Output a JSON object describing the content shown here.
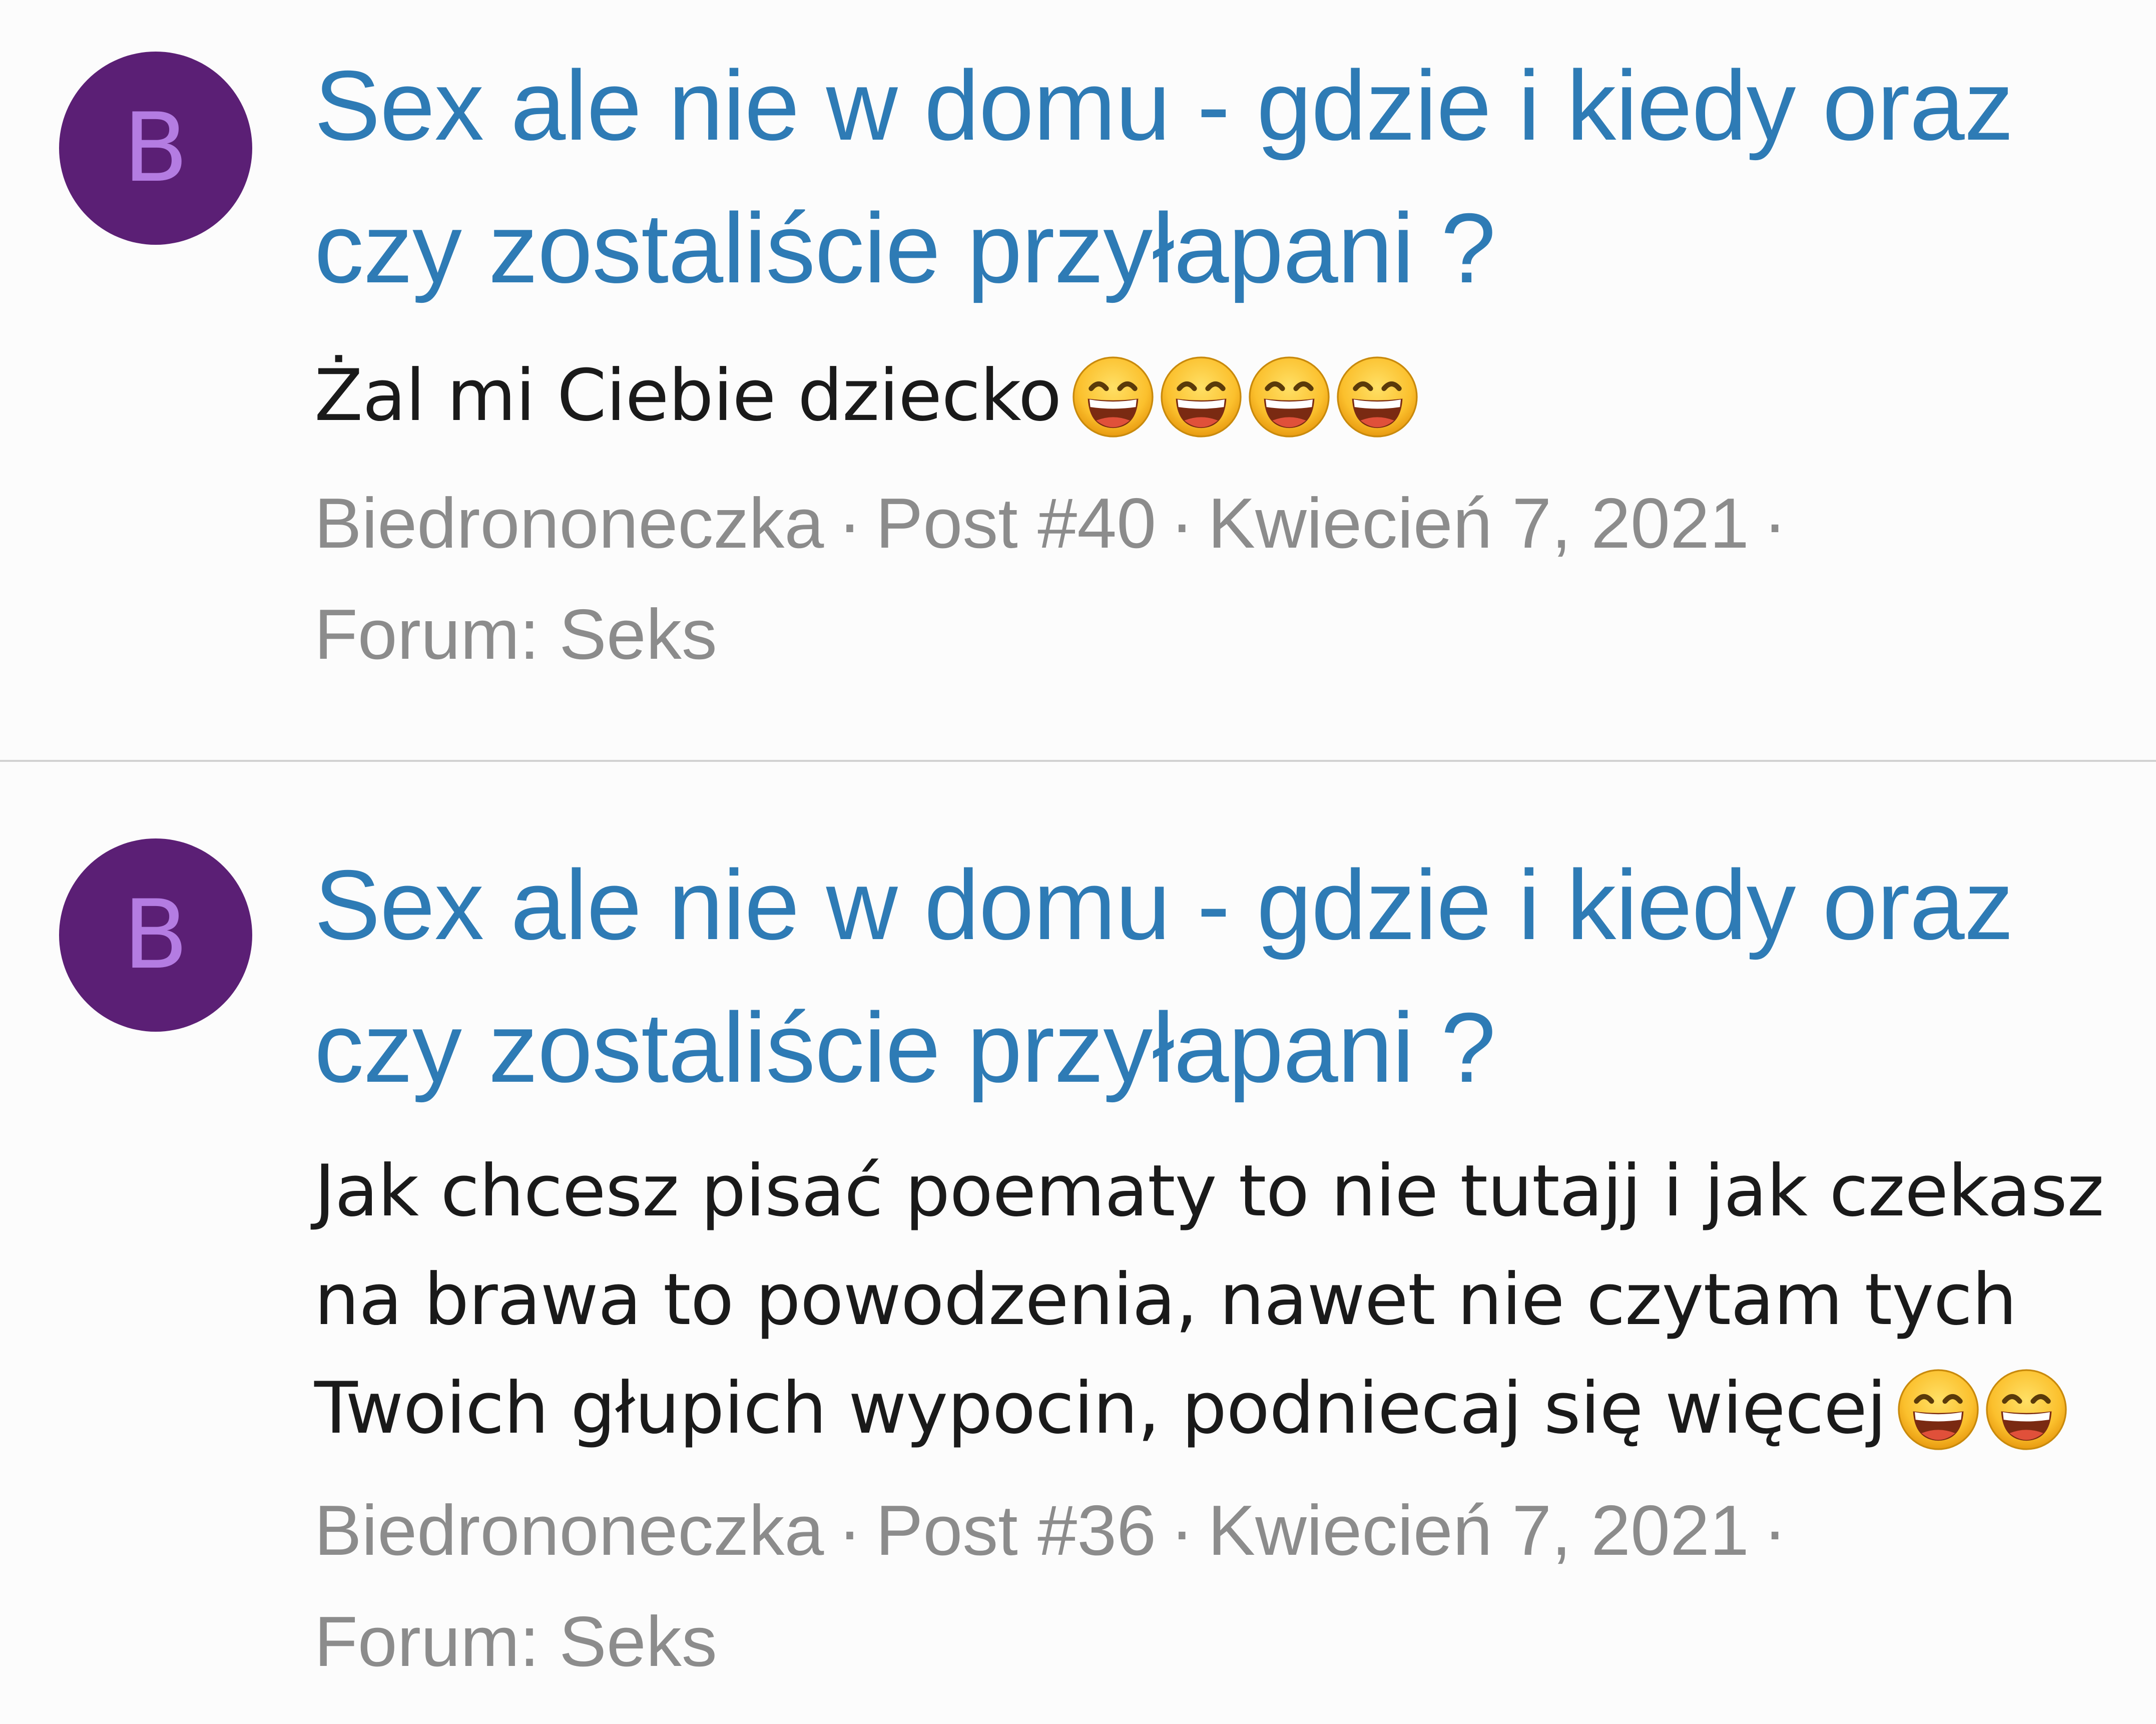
{
  "results": [
    {
      "avatar_letter": "B",
      "title_lines": [
        "Sex ale nie w domu - gdzie i kiedy oraz",
        "czy zostaliście przyłapani ?"
      ],
      "body_lines": [
        "Żal mi Ciebie dziecko"
      ],
      "emoji_count": 4,
      "emoji_icon": "grinning-face-with-smiling-eyes",
      "author": "Biedrononeczka",
      "post": "Post #40",
      "date": "Kwiecień 7, 2021",
      "forum": "Forum: Seks",
      "separator": "·"
    },
    {
      "avatar_letter": "B",
      "title_lines": [
        "Sex ale nie w domu - gdzie i kiedy oraz",
        "czy zostaliście przyłapani ?"
      ],
      "body_lines": [
        "Jak chcesz pisać poematy to nie tutajj i jak czekasz",
        "na brawa to powodzenia, nawet nie czytam tych",
        "Twoich głupich wypocin, podniecaj się więcej"
      ],
      "emoji_count": 2,
      "emoji_icon": "grinning-face-with-smiling-eyes",
      "author": "Biedrononeczka",
      "post": "Post #36",
      "date": "Kwiecień 7, 2021",
      "forum": "Forum: Seks",
      "separator": "·"
    }
  ],
  "colors": {
    "title": "#2e7bb5",
    "avatar_bg": "#5b1f75",
    "avatar_letter": "#b47ce2",
    "meta": "#8c8c8c",
    "body": "#1a1a1a"
  }
}
